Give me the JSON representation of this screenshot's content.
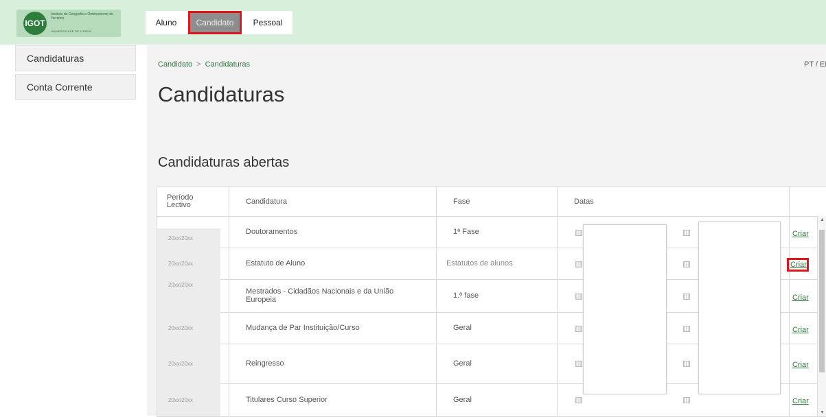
{
  "logo": {
    "abbr": "IGOT",
    "line1": "Instituto de Geografia e Ordenamento do Território",
    "line2": "UNIVERSIDADE DE LISBOA"
  },
  "topnav": {
    "tabs": [
      "Aluno",
      "Candidato",
      "Pessoal"
    ],
    "active": "Candidato"
  },
  "sidebar": {
    "items": [
      "Candidaturas",
      "Conta Corrente"
    ]
  },
  "breadcrumb": {
    "root": "Candidato",
    "separator": ">",
    "current": "Candidaturas"
  },
  "lang": "PT / EN",
  "page_title": "Candidaturas",
  "section_title": "Candidaturas abertas",
  "table": {
    "headers": [
      "Período Lectivo",
      "Candidatura",
      "Fase",
      "Datas",
      ""
    ],
    "rows": [
      {
        "period": "20xx/20xx",
        "candidatura": "Doutoramentos",
        "fase": "1ª Fase",
        "action": "Criar"
      },
      {
        "period": "20xx/20xx",
        "candidatura": "Estatuto de Aluno",
        "fase": "Estatutos de alunos",
        "action": "Criar"
      },
      {
        "period": "20xx/20xx",
        "candidatura": "Mestrados - Cidadãos Nacionais e da União Europeia",
        "fase": "1.ª fase",
        "action": "Criar"
      },
      {
        "period": "20xx/20xx",
        "candidatura": "Mudança de Par Instituição/Curso",
        "fase": "Geral",
        "action": "Criar"
      },
      {
        "period": "20xx/20xx",
        "candidatura": "Reingresso",
        "fase": "Geral",
        "action": "Criar"
      },
      {
        "period": "20xx/20xx",
        "candidatura": "Titulares Curso Superior",
        "fase": "Geral",
        "action": "Criar"
      }
    ]
  },
  "colors": {
    "accent_green": "#2b7a3a",
    "highlight_red": "#e0141c",
    "topbar_bg": "#d8efdb"
  }
}
